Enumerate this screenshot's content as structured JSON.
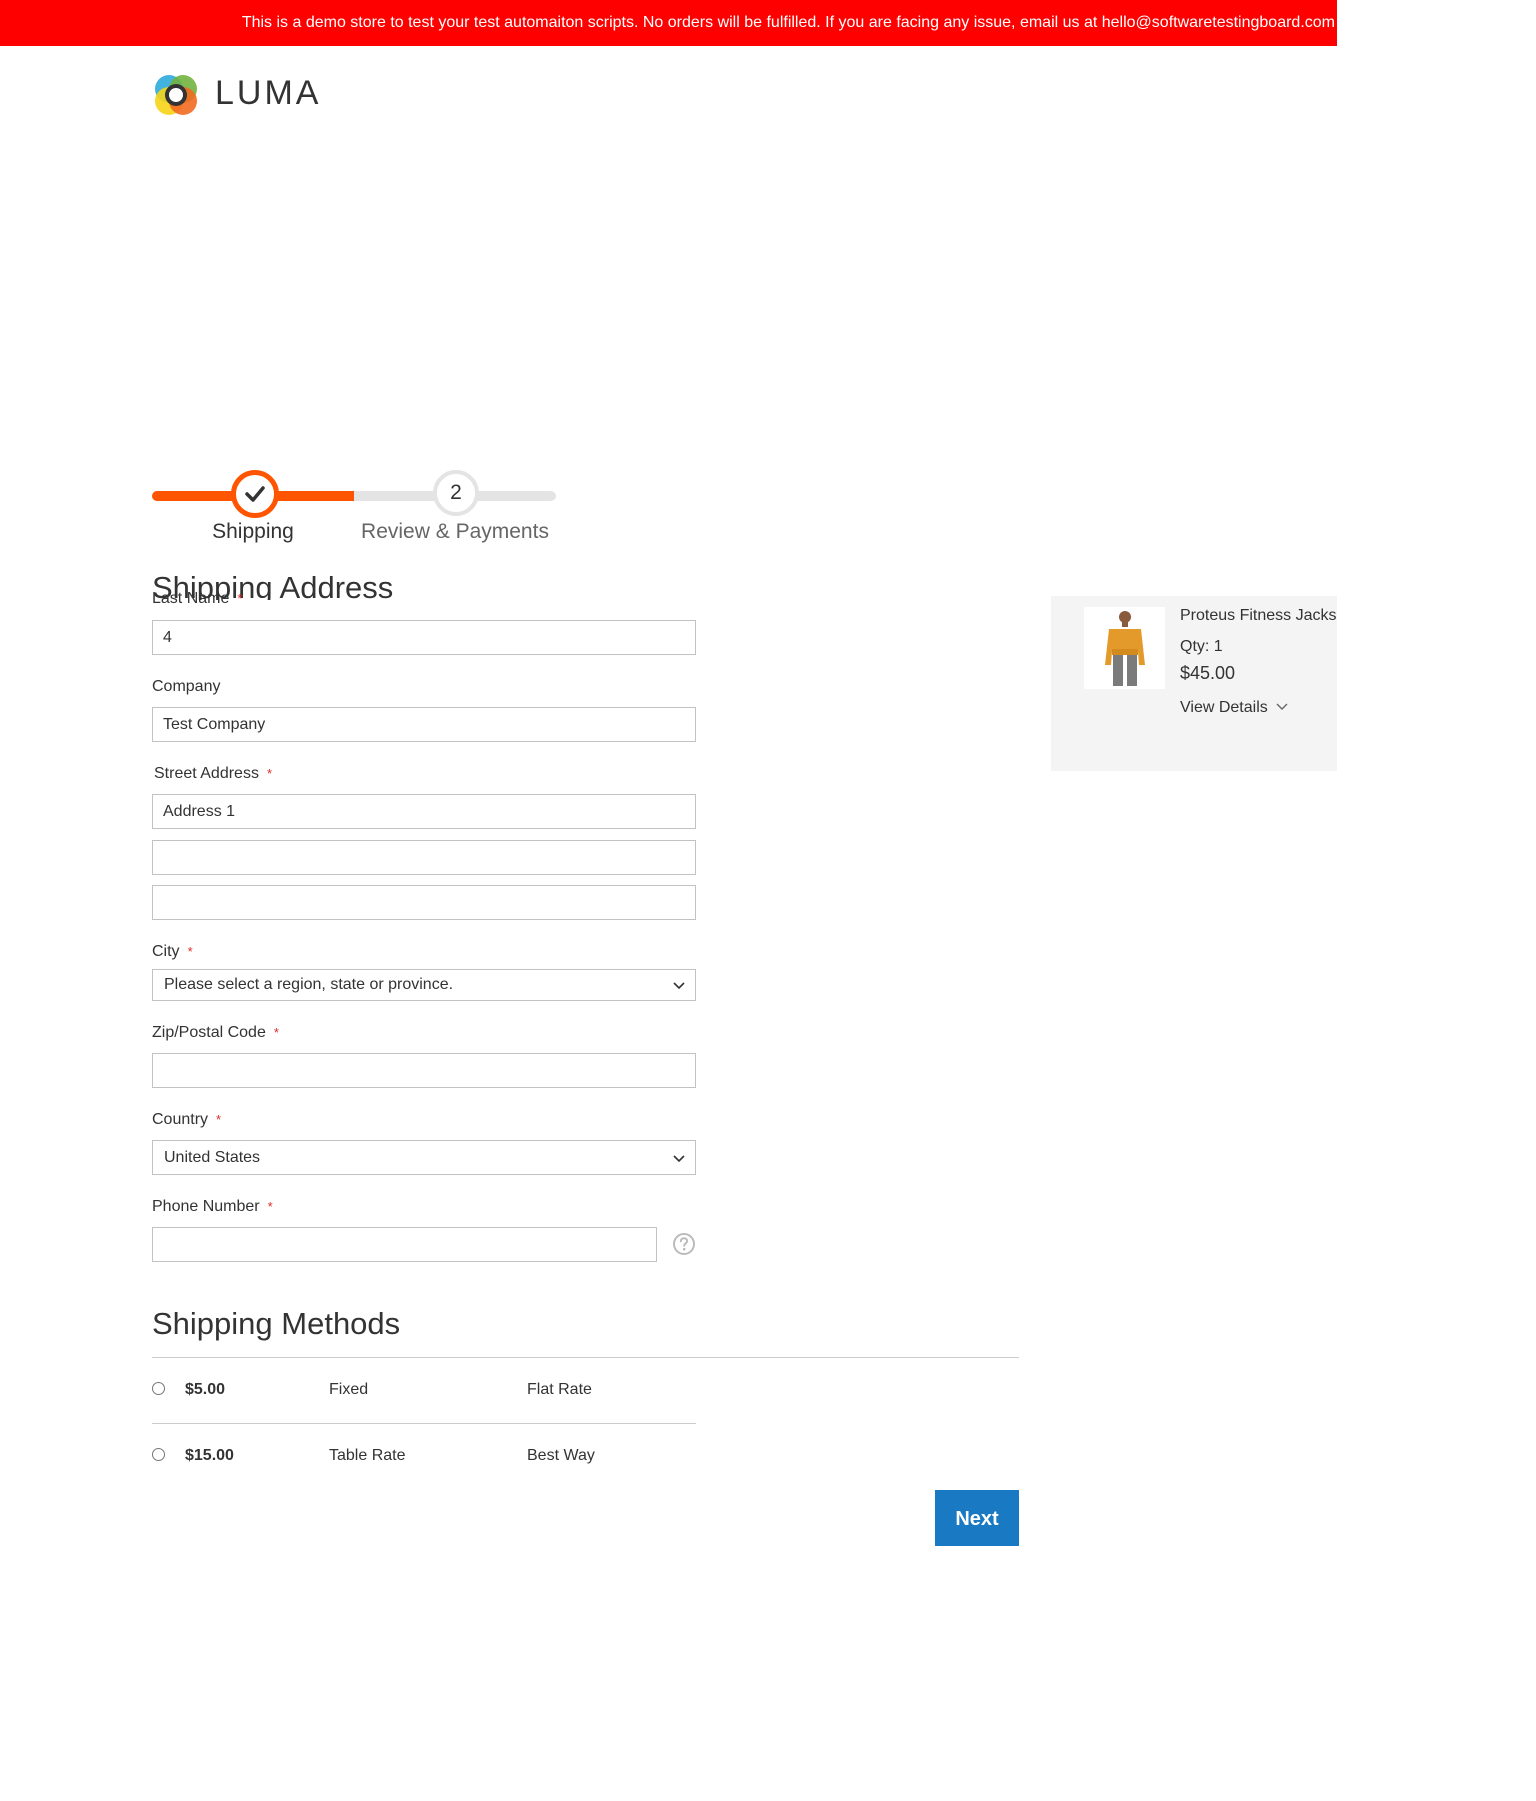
{
  "banner": {
    "text": "This is a demo store to test your test automaiton scripts. No orders will be fulfilled. If you are facing any issue, email us at hello@softwaretestingboard.com"
  },
  "header": {
    "logo_text": "LUMA"
  },
  "progress": {
    "steps": [
      {
        "number": "",
        "label": "Shipping",
        "state": "complete"
      },
      {
        "number": "2",
        "label": "Review & Payments",
        "state": "pending"
      }
    ]
  },
  "shipping_address": {
    "title": "Shipping Address",
    "required_mark": "*",
    "last_name": {
      "label": "Last Name",
      "value": "4"
    },
    "company": {
      "label": "Company",
      "value": "Test Company"
    },
    "street": {
      "label": "Street Address",
      "line1": "Address 1",
      "line2": "",
      "line3": ""
    },
    "city": {
      "label": "City",
      "value": "Please select a region, state or province."
    },
    "zip": {
      "label": "Zip/Postal Code",
      "value": ""
    },
    "country": {
      "label": "Country",
      "value": "United States"
    },
    "phone": {
      "label": "Phone Number",
      "value": ""
    }
  },
  "shipping_methods": {
    "title": "Shipping Methods",
    "rows": [
      {
        "price": "$5.00",
        "method": "Fixed",
        "carrier": "Flat Rate"
      },
      {
        "price": "$15.00",
        "method": "Table Rate",
        "carrier": "Best Way"
      }
    ],
    "next_label": "Next"
  },
  "summary": {
    "product_name": "Proteus Fitness Jackshirt",
    "qty": "Qty: 1",
    "price": "$45.00",
    "view_details": "View Details"
  },
  "colors": {
    "banner": "#ff0000",
    "accent": "#ff5501",
    "primary_button": "#1979c3"
  }
}
